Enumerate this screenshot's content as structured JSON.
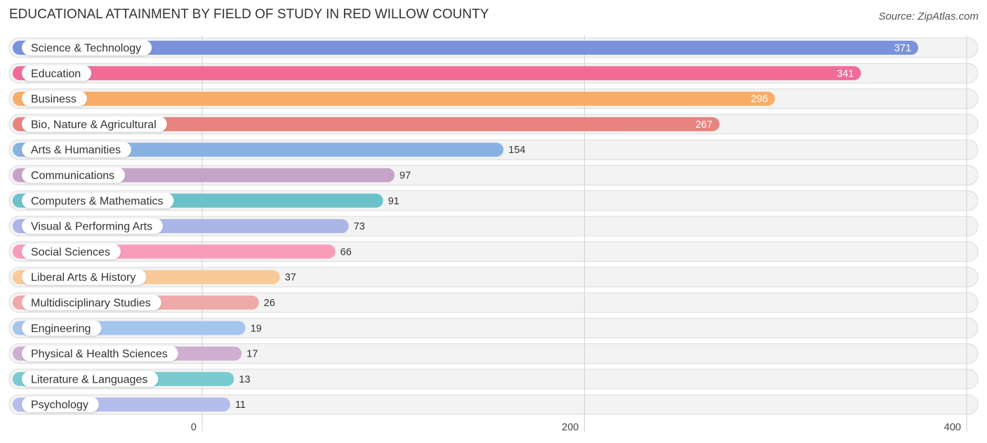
{
  "header": {
    "title": "EDUCATIONAL ATTAINMENT BY FIELD OF STUDY IN RED WILLOW COUNTY",
    "source": "Source: ZipAtlas.com"
  },
  "chart_data": {
    "type": "bar",
    "orientation": "horizontal",
    "title": "EDUCATIONAL ATTAINMENT BY FIELD OF STUDY IN RED WILLOW COUNTY",
    "xlabel": "",
    "ylabel": "",
    "xlim": [
      0,
      400
    ],
    "ticks": [
      0,
      200,
      400
    ],
    "tick_labels": [
      "0",
      "200",
      "400"
    ],
    "grid": true,
    "categories": [
      "Science & Technology",
      "Education",
      "Business",
      "Bio, Nature & Agricultural",
      "Arts & Humanities",
      "Communications",
      "Computers & Mathematics",
      "Visual & Performing Arts",
      "Social Sciences",
      "Liberal Arts & History",
      "Multidisciplinary Studies",
      "Engineering",
      "Physical & Health Sciences",
      "Literature & Languages",
      "Psychology"
    ],
    "values": [
      371,
      341,
      296,
      267,
      154,
      97,
      91,
      73,
      66,
      37,
      26,
      19,
      17,
      13,
      11
    ],
    "value_labels": [
      "371",
      "341",
      "296",
      "267",
      "154",
      "97",
      "91",
      "73",
      "66",
      "37",
      "26",
      "19",
      "17",
      "13",
      "11"
    ],
    "colors": [
      "#7b93dc",
      "#f26b97",
      "#f8ad66",
      "#e8837f",
      "#88b2e2",
      "#c6a3c9",
      "#6cc2cb",
      "#aab5e8",
      "#f79db9",
      "#f9c997",
      "#f0a9a9",
      "#a5c6ec",
      "#cfaed2",
      "#79cbd0",
      "#b5bdec"
    ]
  }
}
